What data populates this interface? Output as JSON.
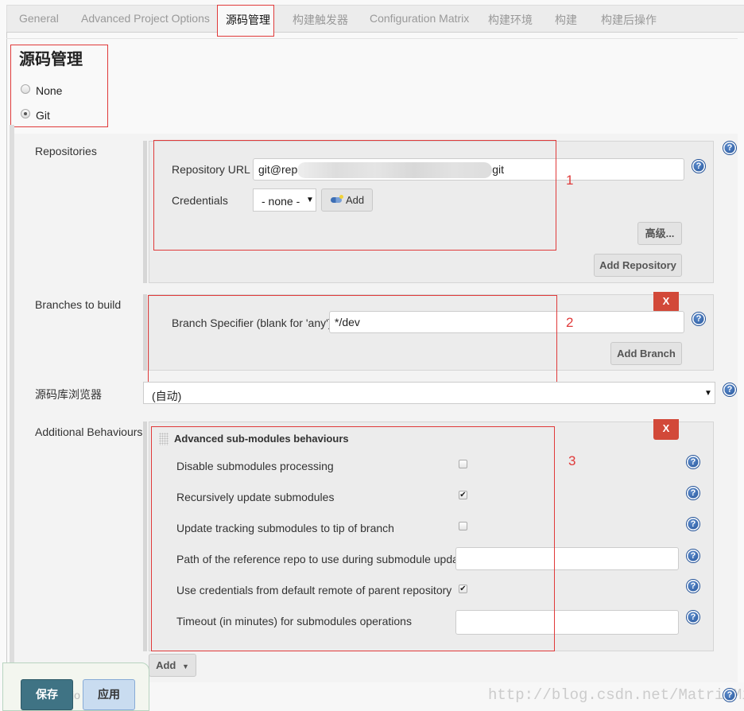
{
  "tabs": [
    {
      "label": "General",
      "active": false
    },
    {
      "label": "Advanced Project Options",
      "active": false
    },
    {
      "label": "源码管理",
      "active": true
    },
    {
      "label": "构建触发器",
      "active": false
    },
    {
      "label": "Configuration Matrix",
      "active": false
    },
    {
      "label": "构建环境",
      "active": false
    },
    {
      "label": "构建",
      "active": false
    },
    {
      "label": "构建后操作",
      "active": false
    }
  ],
  "section": {
    "title": "源码管理",
    "scm_options": [
      {
        "label": "None",
        "selected": false
      },
      {
        "label": "Git",
        "selected": true
      }
    ]
  },
  "repositories": {
    "label": "Repositories",
    "url_label": "Repository URL",
    "url_value_prefix": "git@rep",
    "url_value_suffix": "git",
    "credentials_label": "Credentials",
    "credentials_value": "- none -",
    "add_credentials_label": "Add",
    "advanced_label": "高级...",
    "add_repository_label": "Add Repository",
    "annotation": "1"
  },
  "branches": {
    "label": "Branches to build",
    "specifier_label": "Branch Specifier (blank for 'any')",
    "specifier_value": "*/dev",
    "remove_label": "X",
    "add_branch_label": "Add Branch",
    "annotation": "2"
  },
  "browser": {
    "label": "源码库浏览器",
    "value": "(自动)"
  },
  "behaviours": {
    "label": "Additional Behaviours",
    "block_title": "Advanced sub-modules behaviours",
    "remove_label": "X",
    "annotation": "3",
    "options": [
      {
        "label": "Disable submodules processing",
        "type": "checkbox",
        "checked": false
      },
      {
        "label": "Recursively update submodules",
        "type": "checkbox",
        "checked": true
      },
      {
        "label": "Update tracking submodules to tip of branch",
        "type": "checkbox",
        "checked": false
      },
      {
        "label": "Path of the reference repo to use during submodule update",
        "type": "text",
        "value": ""
      },
      {
        "label": "Use credentials from default remote of parent repository",
        "type": "checkbox",
        "checked": true
      },
      {
        "label": "Timeout (in minutes) for submodules operations",
        "type": "text",
        "value": ""
      }
    ],
    "add_label": "Add"
  },
  "footer": {
    "save_label": "保存",
    "apply_label": "应用",
    "hidden_text": "io",
    "watermark": "http://blog.csdn.net/MatrixMin"
  },
  "help_icon_glyph": "?",
  "check_glyph": "✔",
  "caret_glyph": "▼",
  "colors": {
    "annotation_red": "#e03a3a",
    "remove_button": "#d24939",
    "save_button": "#3f7384",
    "apply_button": "#c9dcf0",
    "help_icon": "#1f4f96"
  }
}
